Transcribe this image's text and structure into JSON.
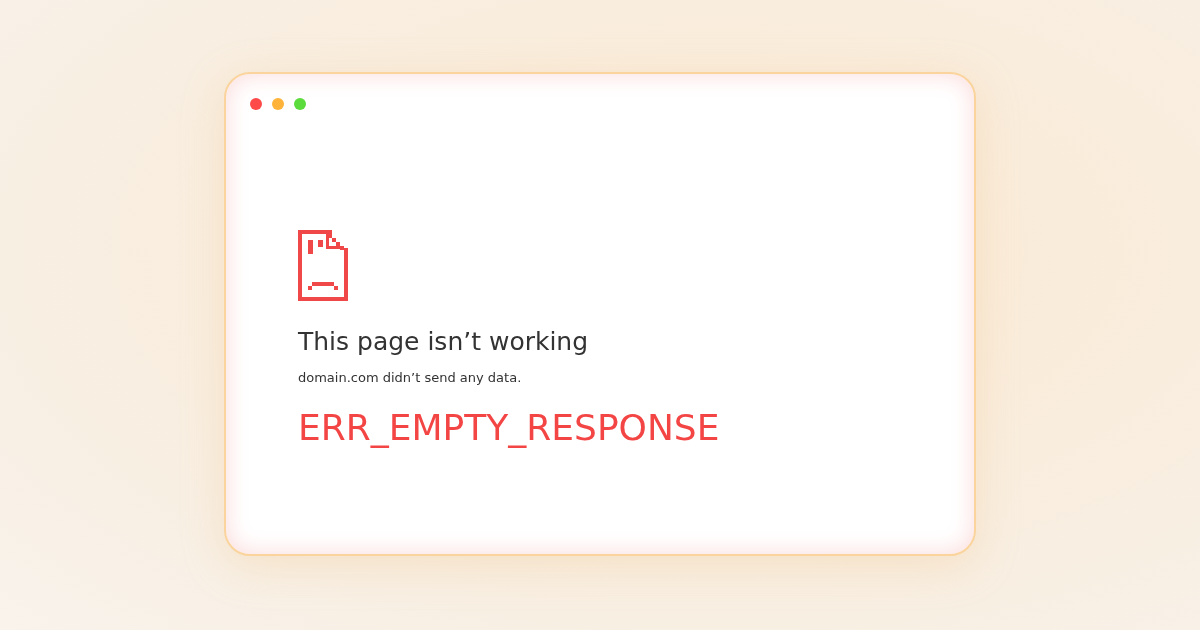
{
  "window": {
    "controls": [
      {
        "color": "#ff4a4a"
      },
      {
        "color": "#ffb33a"
      },
      {
        "color": "#5cdc3c"
      }
    ]
  },
  "error_page": {
    "title": "This page isn’t working",
    "message": "domain.com didn’t send any data.",
    "error_code": "ERR_EMPTY_RESPONSE"
  }
}
